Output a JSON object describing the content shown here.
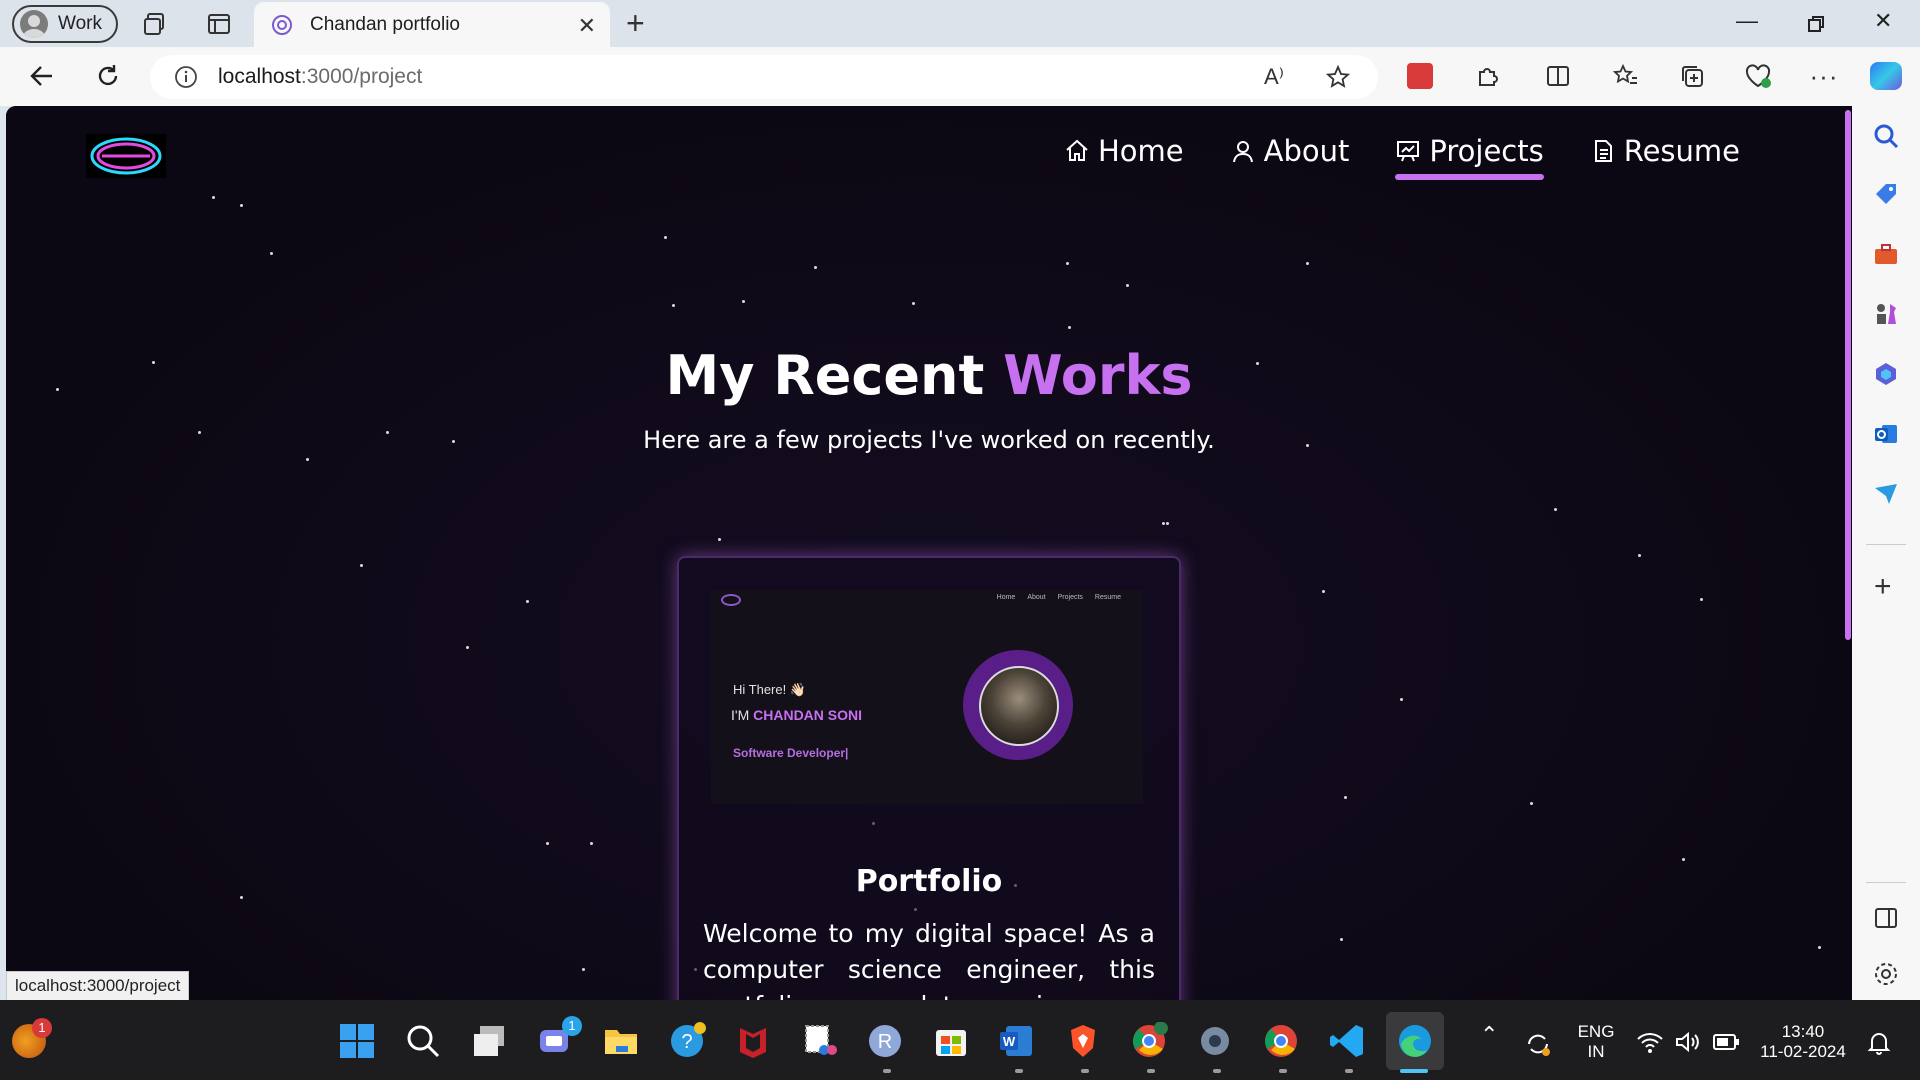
{
  "browser": {
    "profile_label": "Work",
    "tab_title": "Chandan portfolio",
    "url_host": "localhost",
    "url_path": ":3000/project",
    "status_url": "localhost:3000/project"
  },
  "site": {
    "nav": [
      {
        "label": "Home",
        "icon": "home-icon"
      },
      {
        "label": "About",
        "icon": "user-icon"
      },
      {
        "label": "Projects",
        "icon": "chart-icon",
        "active": true
      },
      {
        "label": "Resume",
        "icon": "document-icon"
      }
    ],
    "hero_title_plain": "My Recent",
    "hero_title_accent": "Works",
    "hero_subtitle": "Here are a few projects I've worked on recently.",
    "accent_color": "#c770f0",
    "card": {
      "preview": {
        "nav": [
          "Home",
          "About",
          "Projects",
          "Resume"
        ],
        "greeting": "Hi There! 👋🏻",
        "name_prefix": "I'M",
        "name": "CHANDAN SONI",
        "role": "Software Developer|"
      },
      "title": "Portfolio",
      "description": "Welcome to my digital space! As a computer science engineer, this portfolio encapsulates my journey"
    }
  },
  "taskbar": {
    "notif_badge": "1",
    "teams_badge": "1",
    "lang_top": "ENG",
    "lang_bottom": "IN",
    "time": "13:40",
    "date": "11-02-2024"
  }
}
